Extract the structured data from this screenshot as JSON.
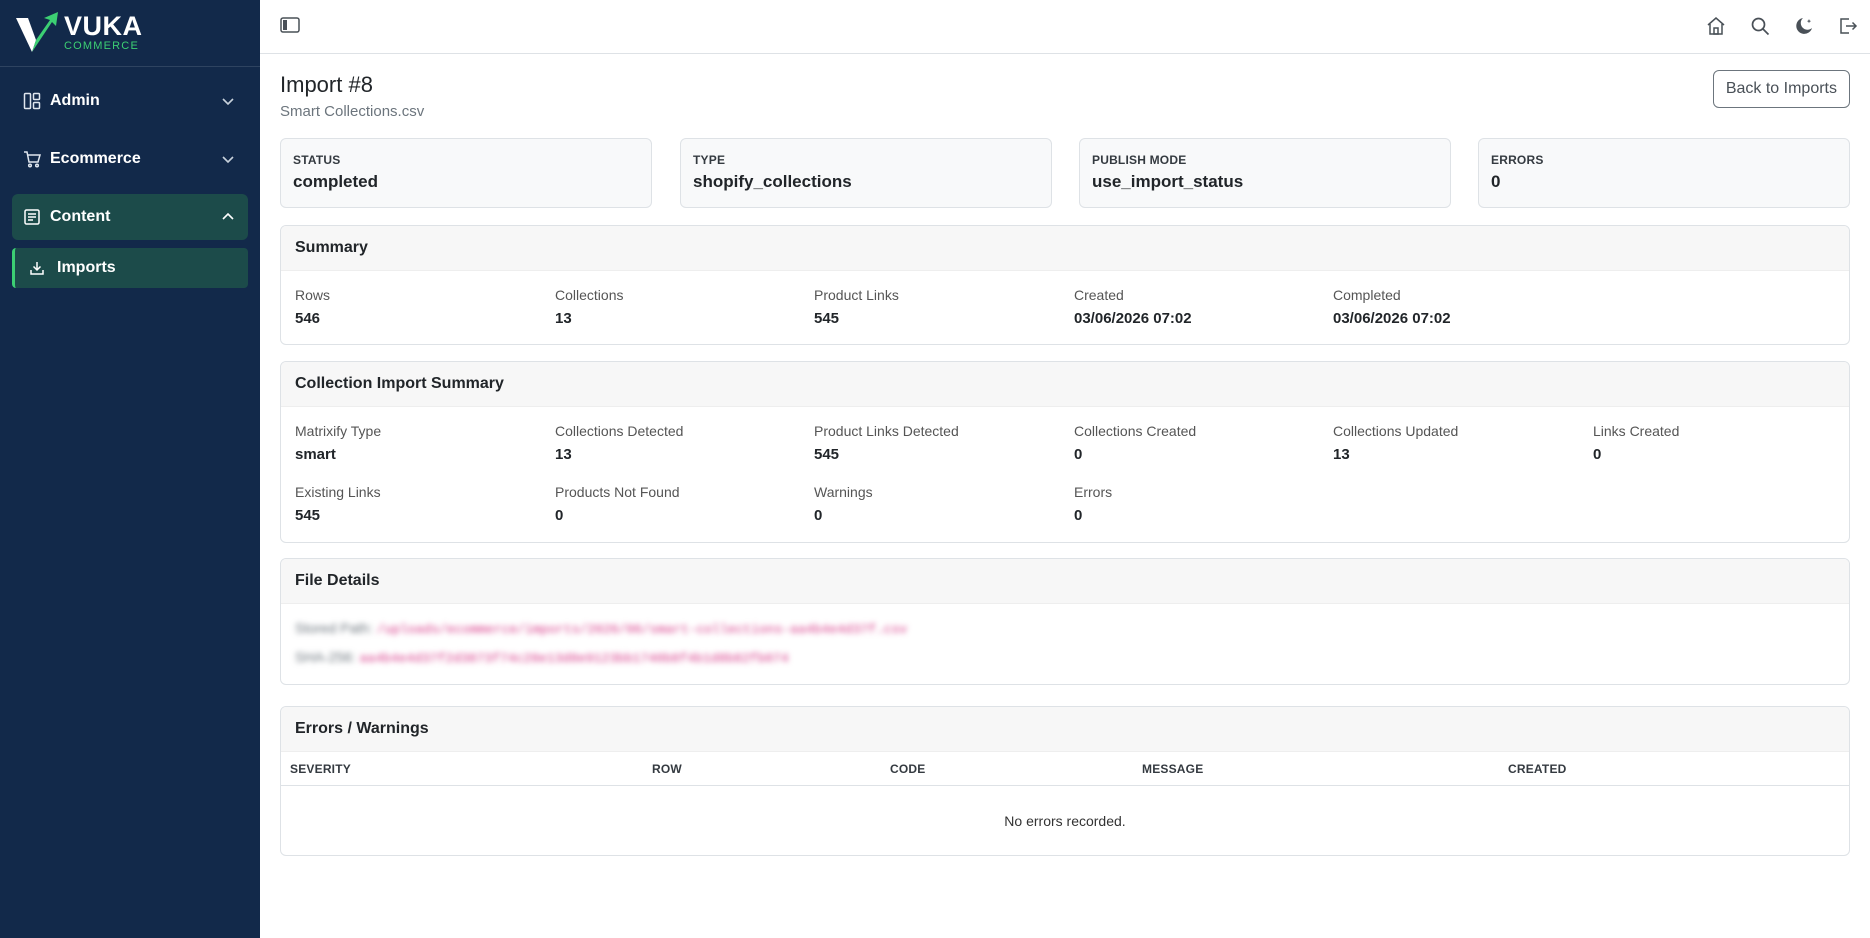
{
  "brand": {
    "name": "VUKA",
    "sub": "COMMERCE",
    "accent": "#3ccf73",
    "sidebar_bg": "#12294a"
  },
  "sidebar": {
    "items": [
      {
        "label": "Admin",
        "icon": "layout-dashboard-icon",
        "expanded": false
      },
      {
        "label": "Ecommerce",
        "icon": "cart-icon",
        "expanded": false
      },
      {
        "label": "Content",
        "icon": "document-icon",
        "expanded": true
      }
    ],
    "sub_items": [
      {
        "label": "Imports",
        "icon": "download-icon",
        "active": true
      }
    ]
  },
  "topbar": {
    "icons": [
      "home-icon",
      "search-icon",
      "moon-icon",
      "logout-icon"
    ]
  },
  "page": {
    "title": "Import #8",
    "subtitle": "Smart Collections.csv",
    "back_label": "Back to Imports"
  },
  "stats": [
    {
      "label": "STATUS",
      "value": "completed"
    },
    {
      "label": "TYPE",
      "value": "shopify_collections"
    },
    {
      "label": "PUBLISH MODE",
      "value": "use_import_status"
    },
    {
      "label": "ERRORS",
      "value": "0"
    }
  ],
  "summary": {
    "title": "Summary",
    "fields": [
      {
        "label": "Rows",
        "value": "546"
      },
      {
        "label": "Collections",
        "value": "13"
      },
      {
        "label": "Product Links",
        "value": "545"
      },
      {
        "label": "Created",
        "value": "03/06/2026 07:02"
      },
      {
        "label": "Completed",
        "value": "03/06/2026 07:02"
      }
    ]
  },
  "collection_summary": {
    "title": "Collection Import Summary",
    "fields": [
      {
        "label": "Matrixify Type",
        "value": "smart"
      },
      {
        "label": "Collections Detected",
        "value": "13"
      },
      {
        "label": "Product Links Detected",
        "value": "545"
      },
      {
        "label": "Collections Created",
        "value": "0"
      },
      {
        "label": "Collections Updated",
        "value": "13"
      },
      {
        "label": "Links Created",
        "value": "0"
      },
      {
        "label": "Existing Links",
        "value": "545"
      },
      {
        "label": "Products Not Found",
        "value": "0"
      },
      {
        "label": "Warnings",
        "value": "0"
      },
      {
        "label": "Errors",
        "value": "0"
      }
    ]
  },
  "file_details": {
    "title": "File Details",
    "stored_label": "Stored Path:",
    "stored_value": "/uploads/ecommerce/imports/2026/06/smart-collections-aa4b4e4d37f.csv",
    "sha_label": "SHA-256:",
    "sha_value": "aa4b4e4d37f2d3873f74c28e13d8e9123bb1740b8f4b1d8b82fb074"
  },
  "errors": {
    "title": "Errors / Warnings",
    "columns": [
      "SEVERITY",
      "ROW",
      "CODE",
      "MESSAGE",
      "CREATED"
    ],
    "empty_text": "No errors recorded."
  }
}
